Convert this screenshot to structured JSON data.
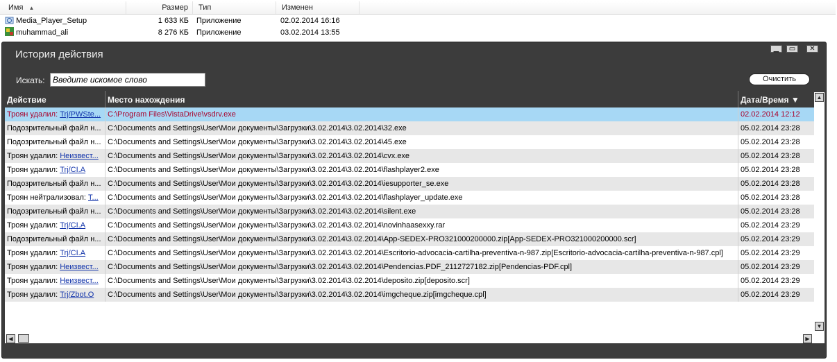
{
  "explorer": {
    "columns": [
      "Имя",
      "Размер",
      "Тип",
      "Изменен"
    ],
    "files": [
      {
        "name": "Media_Player_Setup",
        "size": "1 633 КБ",
        "type": "Приложение",
        "modified": "02.02.2014 16:16"
      },
      {
        "name": "muhammad_ali",
        "size": "8 276 КБ",
        "type": "Приложение",
        "modified": "03.02.2014 13:55"
      }
    ]
  },
  "window": {
    "title": "История действия",
    "search_label": "Искать:",
    "search_placeholder": "Введите искомое слово",
    "clear_button": "Очистить",
    "columns": {
      "action": "Действие",
      "location": "Место нахождения",
      "datetime": "Дата/Время"
    },
    "sort_indicator": "▼",
    "rows": [
      {
        "action": "Троян удалил: ",
        "link": "Trj/PWSte...",
        "location": "C:\\Program Files\\VistaDrive\\vsdrv.exe",
        "datetime": "02.02.2014 12:12"
      },
      {
        "action": "Подозрительный файл н...",
        "link": "",
        "location": "C:\\Documents and Settings\\User\\Мои документы\\Загрузки\\3.02.2014\\3.02.2014\\32.exe",
        "datetime": "05.02.2014 23:28"
      },
      {
        "action": "Подозрительный файл н...",
        "link": "",
        "location": "C:\\Documents and Settings\\User\\Мои документы\\Загрузки\\3.02.2014\\3.02.2014\\45.exe",
        "datetime": "05.02.2014 23:28"
      },
      {
        "action": "Троян удалил: ",
        "link": "Неизвест...",
        "location": "C:\\Documents and Settings\\User\\Мои документы\\Загрузки\\3.02.2014\\3.02.2014\\cvx.exe",
        "datetime": "05.02.2014 23:28"
      },
      {
        "action": "Троян удалил: ",
        "link": "Trj/CI.A",
        "location": "C:\\Documents and Settings\\User\\Мои документы\\Загрузки\\3.02.2014\\3.02.2014\\flashplayer2.exe",
        "datetime": "05.02.2014 23:28"
      },
      {
        "action": "Подозрительный файл н...",
        "link": "",
        "location": "C:\\Documents and Settings\\User\\Мои документы\\Загрузки\\3.02.2014\\3.02.2014\\iesupporter_se.exe",
        "datetime": "05.02.2014 23:28"
      },
      {
        "action": "Троян нейтрализовал: ",
        "link": "T...",
        "location": "C:\\Documents and Settings\\User\\Мои документы\\Загрузки\\3.02.2014\\3.02.2014\\flashplayer_update.exe",
        "datetime": "05.02.2014 23:28"
      },
      {
        "action": "Подозрительный файл н...",
        "link": "",
        "location": "C:\\Documents and Settings\\User\\Мои документы\\Загрузки\\3.02.2014\\3.02.2014\\silent.exe",
        "datetime": "05.02.2014 23:28"
      },
      {
        "action": "Троян удалил: ",
        "link": "Trj/CI.A",
        "location": "C:\\Documents and Settings\\User\\Мои документы\\Загрузки\\3.02.2014\\3.02.2014\\novinhaasexxy.rar",
        "datetime": "05.02.2014 23:29"
      },
      {
        "action": "Подозрительный файл н...",
        "link": "",
        "location": "C:\\Documents and Settings\\User\\Мои документы\\Загрузки\\3.02.2014\\3.02.2014\\App-SEDEX-PRO321000200000.zip[App-SEDEX-PRO321000200000.scr]",
        "datetime": "05.02.2014 23:29"
      },
      {
        "action": "Троян удалил: ",
        "link": "Trj/CI.A",
        "location": "C:\\Documents and Settings\\User\\Мои документы\\Загрузки\\3.02.2014\\3.02.2014\\Escritorio-advocacia-cartilha-preventiva-n-987.zip[Escritorio-advocacia-cartilha-preventiva-n-987.cpl]",
        "datetime": "05.02.2014 23:29"
      },
      {
        "action": "Троян удалил: ",
        "link": "Неизвест...",
        "location": "C:\\Documents and Settings\\User\\Мои документы\\Загрузки\\3.02.2014\\3.02.2014\\Pendencias.PDF_2112727182.zip[Pendencias-PDF.cpl]",
        "datetime": "05.02.2014 23:29"
      },
      {
        "action": "Троян удалил: ",
        "link": "Неизвест...",
        "location": "C:\\Documents and Settings\\User\\Мои документы\\Загрузки\\3.02.2014\\3.02.2014\\deposito.zip[deposito.scr]",
        "datetime": "05.02.2014 23:29"
      },
      {
        "action": "Троян удалил: ",
        "link": "Trj/Zbot.O",
        "location": "C:\\Documents and Settings\\User\\Мои документы\\Загрузки\\3.02.2014\\3.02.2014\\imgcheque.zip[imgcheque.cpl]",
        "datetime": "05.02.2014 23:29"
      }
    ]
  },
  "colors": {
    "window_bg": "#3c3c3c",
    "selected_row": "#a7d8f5",
    "selected_text": "#a8002a",
    "link": "#1133aa"
  }
}
